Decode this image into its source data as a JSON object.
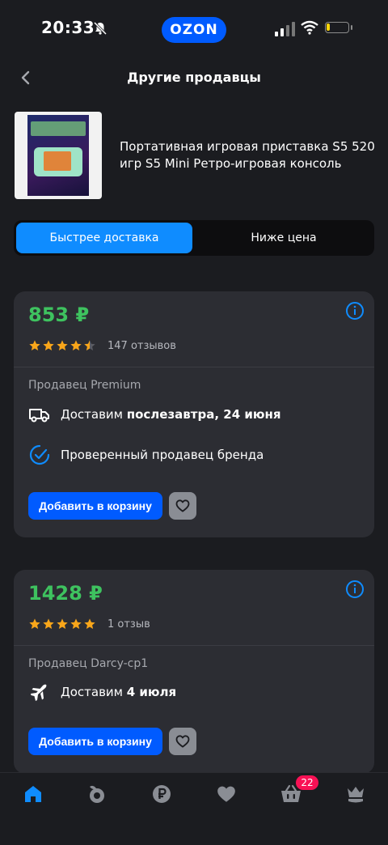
{
  "status_bar": {
    "time": "20:33",
    "brand": "OZON"
  },
  "header": {
    "title": "Другие продавцы"
  },
  "product": {
    "name": "Портативная игровая приставка S5 520 игр S5 Mini Ретро-игровая консоль"
  },
  "tabs": [
    {
      "label": "Быстрее доставка",
      "active": true
    },
    {
      "label": "Ниже цена",
      "active": false
    }
  ],
  "offers": [
    {
      "price": "853 ₽",
      "rating": 4.5,
      "reviews": "147 отзывов",
      "seller": "Продавец Premium",
      "delivery_prefix": "Доставим ",
      "delivery_date": "послезавтра, 24 июня",
      "delivery_icon": "truck-icon",
      "verified": "Проверенный продавец бренда",
      "add_label": "Добавить в корзину"
    },
    {
      "price": "1428 ₽",
      "rating": 5,
      "reviews": "1 отзыв",
      "seller": "Продавец Darcy-cp1",
      "delivery_prefix": "Доставим ",
      "delivery_date": "4 июля",
      "delivery_icon": "airplane-icon",
      "add_label": "Добавить в корзину"
    }
  ],
  "bottom_nav": {
    "items": [
      "home-icon",
      "fresh-icon",
      "finance-icon",
      "favorites-icon",
      "cart-icon",
      "profile-icon"
    ],
    "cart_badge": "22"
  },
  "colors": {
    "accent": "#005bff",
    "tab_active": "#0f8cff",
    "price": "#3ec25f",
    "star": "#f9a61a",
    "badge": "#f91155"
  }
}
